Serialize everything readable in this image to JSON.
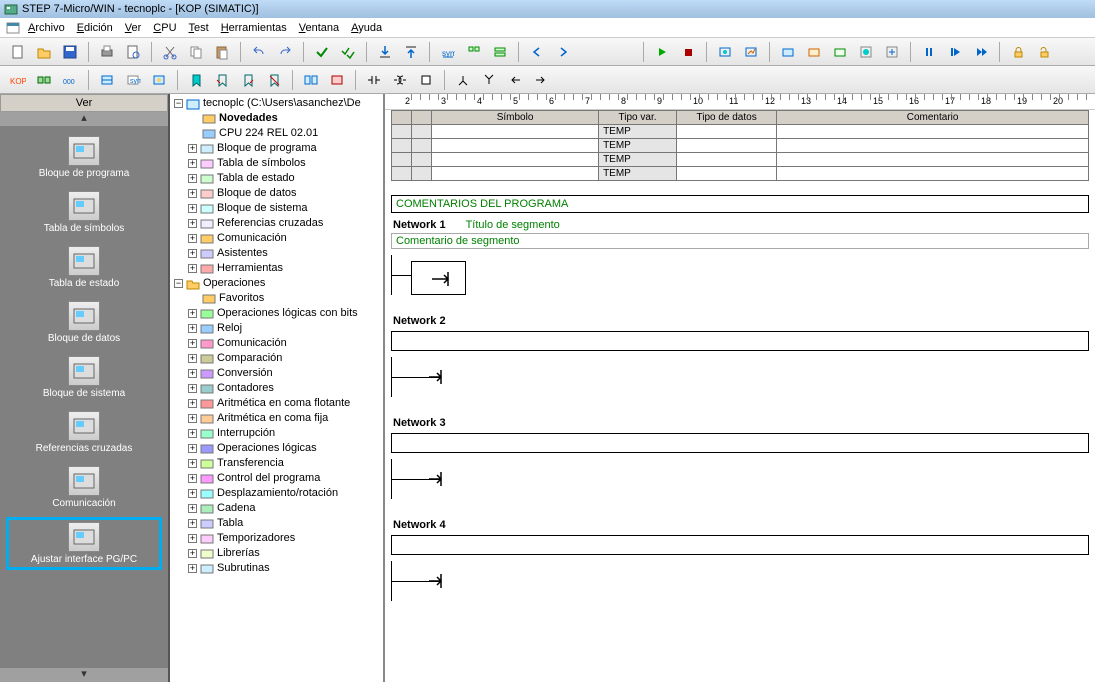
{
  "window": {
    "title": "STEP 7-Micro/WIN - tecnoplc - [KOP (SIMATIC)]"
  },
  "menubar": {
    "items": [
      {
        "label": "Archivo",
        "ul": "A"
      },
      {
        "label": "Edición",
        "ul": "E"
      },
      {
        "label": "Ver",
        "ul": "V"
      },
      {
        "label": "CPU",
        "ul": "C"
      },
      {
        "label": "Test",
        "ul": "T"
      },
      {
        "label": "Herramientas",
        "ul": "H"
      },
      {
        "label": "Ventana",
        "ul": "V"
      },
      {
        "label": "Ayuda",
        "ul": "A"
      }
    ]
  },
  "nav": {
    "header": "Ver",
    "items": [
      {
        "label": "Bloque de programa"
      },
      {
        "label": "Tabla de símbolos"
      },
      {
        "label": "Tabla de estado"
      },
      {
        "label": "Bloque de datos"
      },
      {
        "label": "Bloque de sistema"
      },
      {
        "label": "Referencias cruzadas"
      },
      {
        "label": "Comunicación"
      },
      {
        "label": "Ajustar interface PG/PC"
      }
    ]
  },
  "tree": {
    "root": "tecnoplc (C:\\Users\\asanchez\\De",
    "project": [
      {
        "label": "Novedades",
        "bold": true
      },
      {
        "label": "CPU 224 REL 02.01"
      },
      {
        "label": "Bloque de programa",
        "exp": true
      },
      {
        "label": "Tabla de símbolos",
        "exp": true
      },
      {
        "label": "Tabla de estado",
        "exp": true
      },
      {
        "label": "Bloque de datos",
        "exp": true
      },
      {
        "label": "Bloque de sistema",
        "exp": true
      },
      {
        "label": "Referencias cruzadas",
        "exp": true
      },
      {
        "label": "Comunicación",
        "exp": true
      },
      {
        "label": "Asistentes",
        "exp": true
      },
      {
        "label": "Herramientas",
        "exp": true
      }
    ],
    "ops_label": "Operaciones",
    "ops": [
      "Favoritos",
      "Operaciones lógicas con bits",
      "Reloj",
      "Comunicación",
      "Comparación",
      "Conversión",
      "Contadores",
      "Aritmética en coma flotante",
      "Aritmética en coma fija",
      "Interrupción",
      "Operaciones lógicas",
      "Transferencia",
      "Control del programa",
      "Desplazamiento/rotación",
      "Cadena",
      "Tabla",
      "Temporizadores",
      "Librerías",
      "Subrutinas"
    ]
  },
  "editor": {
    "ruler": [
      2,
      3,
      4,
      5,
      6,
      7,
      8,
      9,
      10,
      11,
      12,
      13,
      14,
      15,
      16,
      17,
      18,
      19,
      20
    ],
    "table": {
      "headers": [
        "Símbolo",
        "Tipo var.",
        "Tipo de datos",
        "Comentario"
      ],
      "rows": [
        {
          "tipovar": "TEMP"
        },
        {
          "tipovar": "TEMP"
        },
        {
          "tipovar": "TEMP"
        },
        {
          "tipovar": "TEMP"
        }
      ]
    },
    "prog_comment": "COMENTARIOS DEL PROGRAMA",
    "networks": [
      {
        "name": "Network 1",
        "title": "Título de segmento",
        "comment": "Comentario de segmento",
        "box": true
      },
      {
        "name": "Network 2"
      },
      {
        "name": "Network 3"
      },
      {
        "name": "Network 4"
      }
    ]
  }
}
